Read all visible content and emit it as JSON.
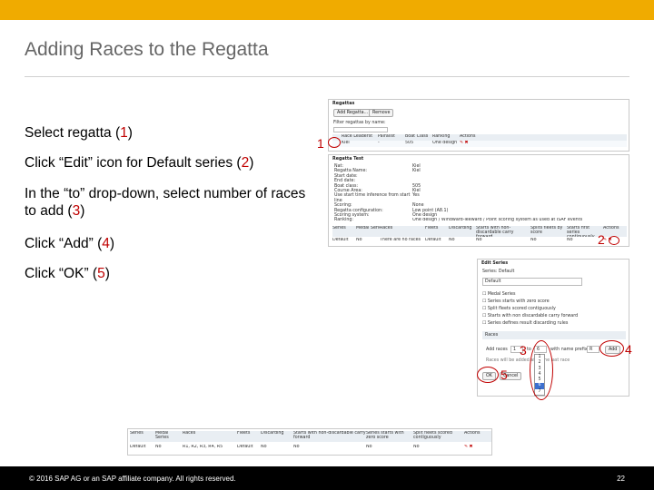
{
  "slide": {
    "title": "Adding Races to the Regatta",
    "bullets": [
      {
        "text_before": "Select regatta (",
        "num": "1",
        "text_after": ")"
      },
      {
        "text_before": "Click “Edit” icon for Default series (",
        "num": "2",
        "text_after": ")"
      },
      {
        "text_before": "In the “to” drop-down, select number of races to add (",
        "num": "3",
        "text_after": ")"
      },
      {
        "text_before": "Click “Add” (",
        "num": "4",
        "text_after": ")"
      },
      {
        "text_before": "Click “OK” (",
        "num": "5",
        "text_after": ")"
      }
    ],
    "footer_copyright": "© 2016 SAP AG or an SAP affiliate company. All rights reserved.",
    "page_number": "22"
  },
  "callouts": {
    "c1": "1",
    "c2": "2",
    "c3": "3",
    "c4": "4",
    "c5": "5"
  },
  "regattas_panel": {
    "heading": "Regattas",
    "add_button": "Add Regatta...",
    "remove_button": "Remove",
    "filter_label": "Filter regattas by name:",
    "columns": [
      "",
      "Race Leaderst",
      "Pairalist",
      "Boat Class",
      "Ranking",
      "Actions"
    ],
    "row": [
      "",
      "Kiel",
      "-",
      "505",
      "One design",
      ""
    ]
  },
  "regatta_detail": {
    "heading": "Regatta Test",
    "labels": [
      "Nat:",
      "Regatta Name:",
      "Start date:",
      "End date:",
      "Boat class:",
      "Course Area:",
      "Use start time inference from start line",
      "Scoring:",
      "Regatta configuration:",
      "Scoring system:",
      "Ranking:"
    ],
    "values": [
      "Kiel",
      "Kiel",
      "",
      "",
      "505",
      "Kiel",
      "Yes",
      "",
      "None",
      "Low point (A8.1)",
      "One design"
    ],
    "long_note": "One design / Windward-leeward / Point scoring system as used at ISAF events",
    "columns": [
      "Series",
      "Medal Series",
      "Races",
      "Fleets",
      "Discarding",
      "Starts with non-discardable carry forward",
      "Splits fleets by score",
      "Starts first series contiguously",
      "Actions"
    ],
    "row": [
      "Default",
      "No",
      "There are no races",
      "Default",
      "No",
      "No",
      "No",
      "No",
      ""
    ]
  },
  "edit_series": {
    "heading": "Edit Series",
    "series_label": "Series: Default",
    "name_value": "Default",
    "checks": [
      "Medal Series",
      "Series starts with zero score",
      "Split fleets scored contiguously",
      "Starts with non discardable carry forward",
      "Series defines result discarding rules"
    ],
    "tab_label": "Races",
    "add_races_label": "Add races",
    "from_value": "1",
    "to_label": "to",
    "to_value": "6",
    "dropdown_options": [
      "1",
      "2",
      "3",
      "4",
      "5",
      "6",
      "7"
    ],
    "with_name_prefix": "with name prefix",
    "prefix_value": "R",
    "add_button": "Add",
    "hint_text": "Races will be added after the last race",
    "ok_button": "OK",
    "cancel_button": "Cancel"
  },
  "series_result": {
    "columns": [
      "Series",
      "Medal Series",
      "Races",
      "Fleets",
      "Discarding",
      "Starts with non-discardable carry forward",
      "Series starts with zero score",
      "Split fleets scored contiguously",
      "Actions"
    ],
    "row": [
      "Default",
      "No",
      "R1, R2, R3, R4, R5",
      "Default",
      "No",
      "No",
      "No",
      "No",
      ""
    ]
  },
  "colors": {
    "accent_bar": "#f0ab00",
    "callout_red": "#c00000",
    "title_gray": "#666666"
  }
}
